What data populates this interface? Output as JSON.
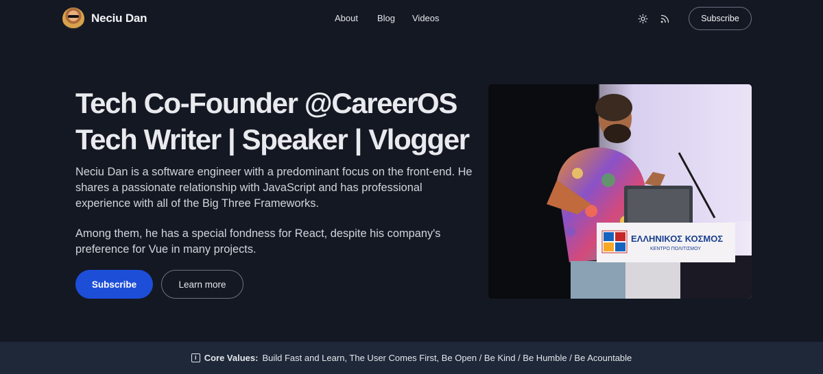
{
  "header": {
    "brand_name": "Neciu Dan",
    "nav": [
      {
        "label": "About"
      },
      {
        "label": "Blog"
      },
      {
        "label": "Videos"
      }
    ],
    "icons": [
      "sun-icon",
      "rss-icon"
    ],
    "subscribe_label": "Subscribe"
  },
  "hero": {
    "title_line_1": "Tech Co-Founder @CareerOS",
    "title_line_2": "Tech Writer | Speaker | Vlogger",
    "paragraph_1": "Neciu Dan is a software engineer with a predominant focus on the front-end. He shares a passionate relationship with JavaScript and has professional experience with all of the Big Three Frameworks.",
    "paragraph_2": "Among them, he has a special fondness for React, despite his company's preference for Vue in many projects.",
    "primary_button": "Subscribe",
    "secondary_button": "Learn more",
    "photo": {
      "podium_title": "ΕΛΛΗΝΙΚΟΣ ΚΟΣΜΟΣ",
      "podium_subtitle": "ΚΕΝΤΡΟ ΠΟΛΙΤΙΣΜΟΥ"
    }
  },
  "core_values": {
    "label": "Core Values:",
    "text": "Build Fast and Learn, The User Comes First, Be Open / Be Kind / Be Humble / Be Acountable",
    "icon": "info-icon"
  },
  "colors": {
    "background": "#141823",
    "primary": "#1d4ed8",
    "bar": "#1e2839"
  }
}
